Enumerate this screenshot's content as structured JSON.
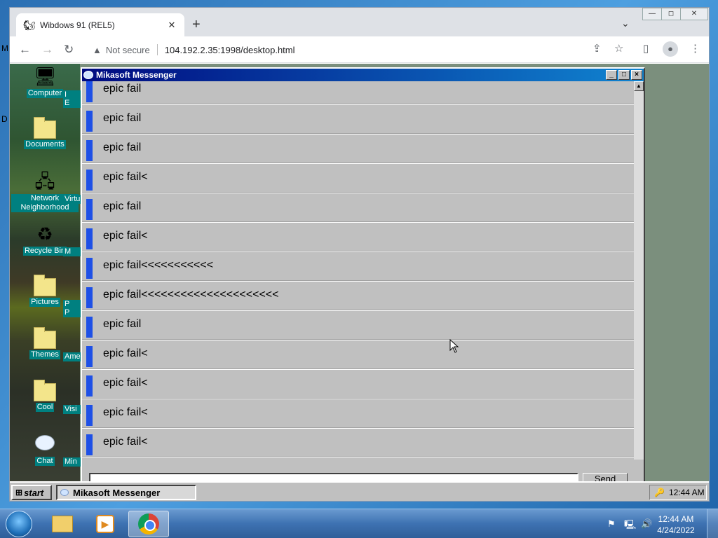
{
  "desktop_edge": {
    "left_letters": [
      "M",
      "D"
    ]
  },
  "browser": {
    "tab_title": "Wibdows 91 (REL5)",
    "tab_close": "✕",
    "new_tab": "+",
    "tab_search": "⌄",
    "window_controls": [
      "—",
      "◻",
      "✕"
    ],
    "nav": {
      "back": "←",
      "forward": "→",
      "reload": "↻"
    },
    "security_icon": "▲",
    "not_secure": "Not secure",
    "url": "104.192.2.35:1998/desktop.html",
    "toolbar_icons": {
      "share": "⇪",
      "bookmark": "☆",
      "sidepanel": "▯",
      "profile": "●",
      "menu": "⋮"
    }
  },
  "desktop_icons": [
    {
      "label": "Computer",
      "icon": "computer-icon",
      "glyph": "🖥"
    },
    {
      "label": "Documents",
      "icon": "documents-folder-icon",
      "glyph": ""
    },
    {
      "label": "Network Neighborhood",
      "icon": "network-icon",
      "glyph": "🖧"
    },
    {
      "label": "Recycle Bin",
      "icon": "recycle-bin-icon",
      "glyph": "♻"
    },
    {
      "label": "Pictures",
      "icon": "folder-icon",
      "glyph": ""
    },
    {
      "label": "Themes",
      "icon": "folder-icon",
      "glyph": ""
    },
    {
      "label": "Cool",
      "icon": "folder-icon",
      "glyph": ""
    },
    {
      "label": "Chat",
      "icon": "chat-icon",
      "glyph": ""
    }
  ],
  "desktop_col2": [
    "I",
    "E",
    "Virtu",
    "M",
    "P",
    "P",
    "Ame",
    "Visi",
    "Min"
  ],
  "messenger": {
    "title": "Mikasoft Messenger",
    "title_buttons": [
      "_",
      "□",
      "×"
    ],
    "messages": [
      "epic fail",
      "epic fail",
      "epic fail",
      "epic fail<",
      "epic fail",
      "epic fail<",
      "epic fail<<<<<<<<<<<",
      "epic fail<<<<<<<<<<<<<<<<<<<<<",
      "epic fail",
      "epic fail<",
      "epic fail<",
      "epic fail<",
      "epic fail<"
    ],
    "scroll_up": "▲",
    "send_label": "Send"
  },
  "w98_taskbar": {
    "start_label": "start",
    "task_label": "Mikasoft Messenger",
    "clock": "12:44 AM"
  },
  "w7_taskbar": {
    "time": "12:44 AM",
    "date": "4/24/2022",
    "tray_icons": [
      "⚑",
      "🖳",
      "🔊"
    ]
  },
  "colors": {
    "messenger_title_start": "#000a80",
    "messenger_title_end": "#1084d0",
    "message_bar": "#1e50e6",
    "w98_face": "#c0c0c0",
    "desktop_label_bg": "#008080"
  }
}
